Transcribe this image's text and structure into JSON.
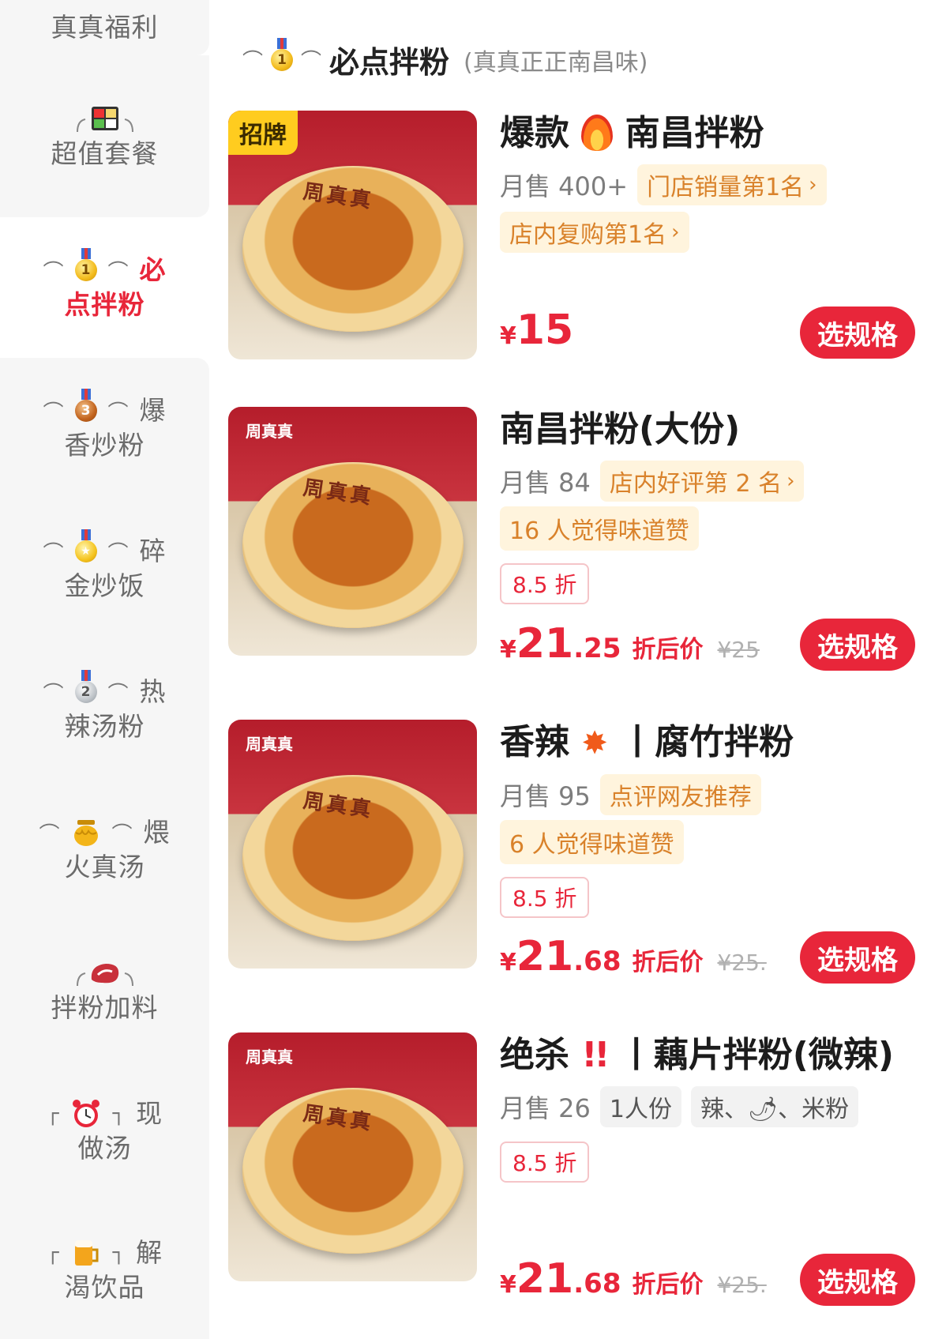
{
  "sidebar": {
    "items": [
      {
        "line1": "",
        "line2": "真真福利",
        "icon": "heart-icon"
      },
      {
        "line1": "",
        "line2": "超值套餐",
        "icon": "bento-icon"
      },
      {
        "line1": "必",
        "line2": "点拌粉",
        "icon": "gold-medal-icon",
        "medal": "1"
      },
      {
        "line1": "爆",
        "line2": "香炒粉",
        "icon": "bronze-medal-icon",
        "medal": "3"
      },
      {
        "line1": "碎",
        "line2": "金炒饭",
        "icon": "star-medal-icon",
        "medal": "★"
      },
      {
        "line1": "热",
        "line2": "辣汤粉",
        "icon": "silver-medal-icon",
        "medal": "2"
      },
      {
        "line1": "煨",
        "line2": "火真汤",
        "icon": "honey-pot-icon"
      },
      {
        "line1": "",
        "line2": "拌粉加料",
        "icon": "meat-icon"
      },
      {
        "line1": "现",
        "line2": "做汤",
        "icon": "alarm-clock-icon"
      },
      {
        "line1": "解",
        "line2": "渴饮品",
        "icon": "beer-mug-icon"
      }
    ]
  },
  "category": {
    "title": "必点拌粉",
    "subtitle": "(真真正正南昌味)"
  },
  "products": [
    {
      "name_a": "爆款",
      "name_b": "南昌拌粉",
      "sales": "月售 400+",
      "rank": "门店销量第1名",
      "badge": "店内复购第1名",
      "thumb_tag": "招牌",
      "price_int": "15",
      "price_dec": "",
      "button": "选规格"
    },
    {
      "name": "南昌拌粉(大份)",
      "sales": "月售 84",
      "rank": "店内好评第 2 名",
      "praise": "16 人觉得味道赞",
      "discount": "8.5 折",
      "price_int": "21",
      "price_dec": ".25",
      "after": "折后价",
      "orig": "¥25",
      "button": "选规格"
    },
    {
      "name_a": "香辣",
      "name_b": "丨腐竹拌粉",
      "sales": "月售 95",
      "rank": "点评网友推荐",
      "praise": "6 人觉得味道赞",
      "discount": "8.5 折",
      "price_int": "21",
      "price_dec": ".68",
      "after": "折后价",
      "orig": "¥25.",
      "button": "选规格"
    },
    {
      "name_a": "绝杀",
      "name_b": "丨藕片拌粉(微辣)",
      "sales": "月售 26",
      "tag1": "1人份",
      "tag2": "辣、🌶、米粉",
      "discount": "8.5 折",
      "price_int": "21",
      "price_dec": ".68",
      "after": "折后价",
      "orig": "¥25.",
      "button": "选规格"
    }
  ],
  "currency": "¥",
  "thumb_brand": "周真真",
  "bowl_text": "周真真",
  "colors": {
    "accent": "#e8263a",
    "tag_bg": "#fff4dd",
    "tag_text": "#d9822b",
    "sidebar_bg": "#f6f6f6"
  }
}
